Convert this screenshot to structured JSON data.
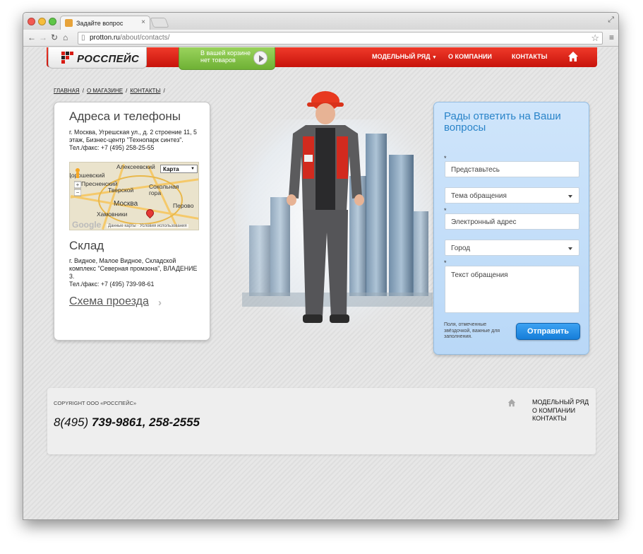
{
  "browser": {
    "tab_title": "Задайте вопрос",
    "tab_close": "×",
    "url_host": "protton.ru",
    "url_path": "/about/contacts/"
  },
  "site": {
    "logo_text": "РОССПЕЙС",
    "brand_red": "#e0251a",
    "cart_line1": "В вашей корзине",
    "cart_line2": "нет товаров",
    "nav": [
      {
        "label": "МОДЕЛЬНЫЙ РЯД"
      },
      {
        "label": "О КОМПАНИИ"
      },
      {
        "label": "КОНТАКТЫ"
      }
    ],
    "home_icon": "home-icon"
  },
  "breadcrumbs": [
    {
      "label": "ГЛАВНАЯ"
    },
    {
      "label": "О МАГАЗИНЕ"
    },
    {
      "label": "КОНТАКТЫ"
    }
  ],
  "breadcrumb_sep": "/",
  "contacts": {
    "title": "Адреса и телефоны",
    "address": "г. Москва, Угрешская ул., д. 2 строение 11, 5 этаж, Бизнес-центр \"Технопарк синтез\".",
    "phone": "Тел./факс: +7 (495) 258-25-55",
    "map": {
      "type_label": "Карта",
      "labels": [
        "Алексеевский",
        "Дорошевский",
        "Пресненский",
        "Тверской",
        "Сокольная гора",
        "Москва",
        "Перово",
        "Хамовники"
      ],
      "google": "Google",
      "credit": "Данные карты · Условия использования"
    },
    "warehouse_title": "Склад",
    "warehouse_address": "г. Видное, Малое Видное, Складской комплекс \"Северная промзона\", ВЛАДЕНИЕ 3.",
    "warehouse_phone": "Тел./факс: +7 (495) 739-98-61",
    "scheme_link": "Схема проезда"
  },
  "form": {
    "title": "Рады ответить на Ваши вопросы",
    "required_mark": "*",
    "name_placeholder": "Представьтесь",
    "topic_placeholder": "Тема обращения",
    "email_placeholder": "Электронный адрес",
    "city_placeholder": "Город",
    "message_placeholder": "Текст обращения",
    "note": "Поля, отмеченные звёздочкой, важные для заполнения.",
    "submit_label": "Отправить",
    "accent": "#2a84c9"
  },
  "footer": {
    "copyright": "COPYRIGHT ООО «РОССПЕЙС»",
    "phone_prefix": "8(495)",
    "phone_numbers": "739-9861, 258-2555",
    "links": [
      {
        "label": "МОДЕЛЬНЫЙ РЯД"
      },
      {
        "label": "О КОМПАНИИ"
      },
      {
        "label": "КОНТАКТЫ"
      }
    ]
  }
}
